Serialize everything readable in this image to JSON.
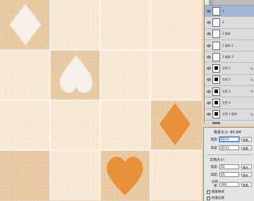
{
  "canvas": {
    "colors": {
      "tile_dark": "#e7c9a2",
      "tile_light": "#f7e8d6",
      "shape_white": "#f6f0e8",
      "shape_orange": "#e8903a"
    },
    "shapes": [
      {
        "name": "white-diamond",
        "kind": "diamond",
        "color": "white"
      },
      {
        "name": "white-heart",
        "kind": "heart",
        "color": "white"
      },
      {
        "name": "orange-diamond",
        "kind": "diamond",
        "color": "orange"
      },
      {
        "name": "orange-heart",
        "kind": "heart",
        "color": "orange"
      }
    ]
  },
  "layers_panel": {
    "tabs": [
      "",
      ""
    ],
    "layers": [
      {
        "name": "1",
        "thumb": "light",
        "fx": "",
        "selected": true
      },
      {
        "name": "2",
        "thumb": "light",
        "fx": "",
        "selected": false
      },
      {
        "name": "2 副本",
        "thumb": "light",
        "fx": "",
        "selected": false
      },
      {
        "name": "2 副本 2",
        "thumb": "light",
        "fx": "",
        "selected": false
      },
      {
        "name": "2 副本 3",
        "thumb": "light",
        "fx": "",
        "selected": false
      },
      {
        "name": "左色 1",
        "thumb": "pattern",
        "fx": "fx",
        "selected": false
      },
      {
        "name": "左色 2",
        "thumb": "pattern",
        "fx": "fx",
        "selected": false
      },
      {
        "name": "左色 3",
        "thumb": "pattern",
        "fx": "fx",
        "selected": false
      },
      {
        "name": "左色 4",
        "thumb": "pattern",
        "fx": "",
        "selected": false
      },
      {
        "name": "左色 1 副本",
        "thumb": "pattern",
        "fx": "fx",
        "selected": false
      },
      {
        "name": "2 副本 4",
        "thumb": "dark",
        "fx": "",
        "selected": false
      },
      {
        "name": "左色 6",
        "thumb": "light",
        "fx": "",
        "selected": false
      }
    ]
  },
  "image_size_dialog": {
    "pixel_dimensions_label": "像素大小: 80.9M",
    "width_label": "宽度:",
    "width_value": "9213",
    "width_unit": "像素",
    "height_label": "高度:",
    "height_value": "9213",
    "height_unit": "像素",
    "document_size_label": "文档大小:",
    "doc_width_label": "宽度:",
    "doc_width_value": "65",
    "doc_width_unit": "厘米",
    "doc_height_label": "高度:",
    "doc_height_value": "65",
    "doc_height_unit": "厘米",
    "resolution_label": "分辨率:",
    "resolution_value": "360",
    "resolution_unit": "像素",
    "scale_styles_label": "缩放样式",
    "scale_styles_checked": true,
    "constrain_label": "约束比例",
    "constrain_checked": true
  }
}
